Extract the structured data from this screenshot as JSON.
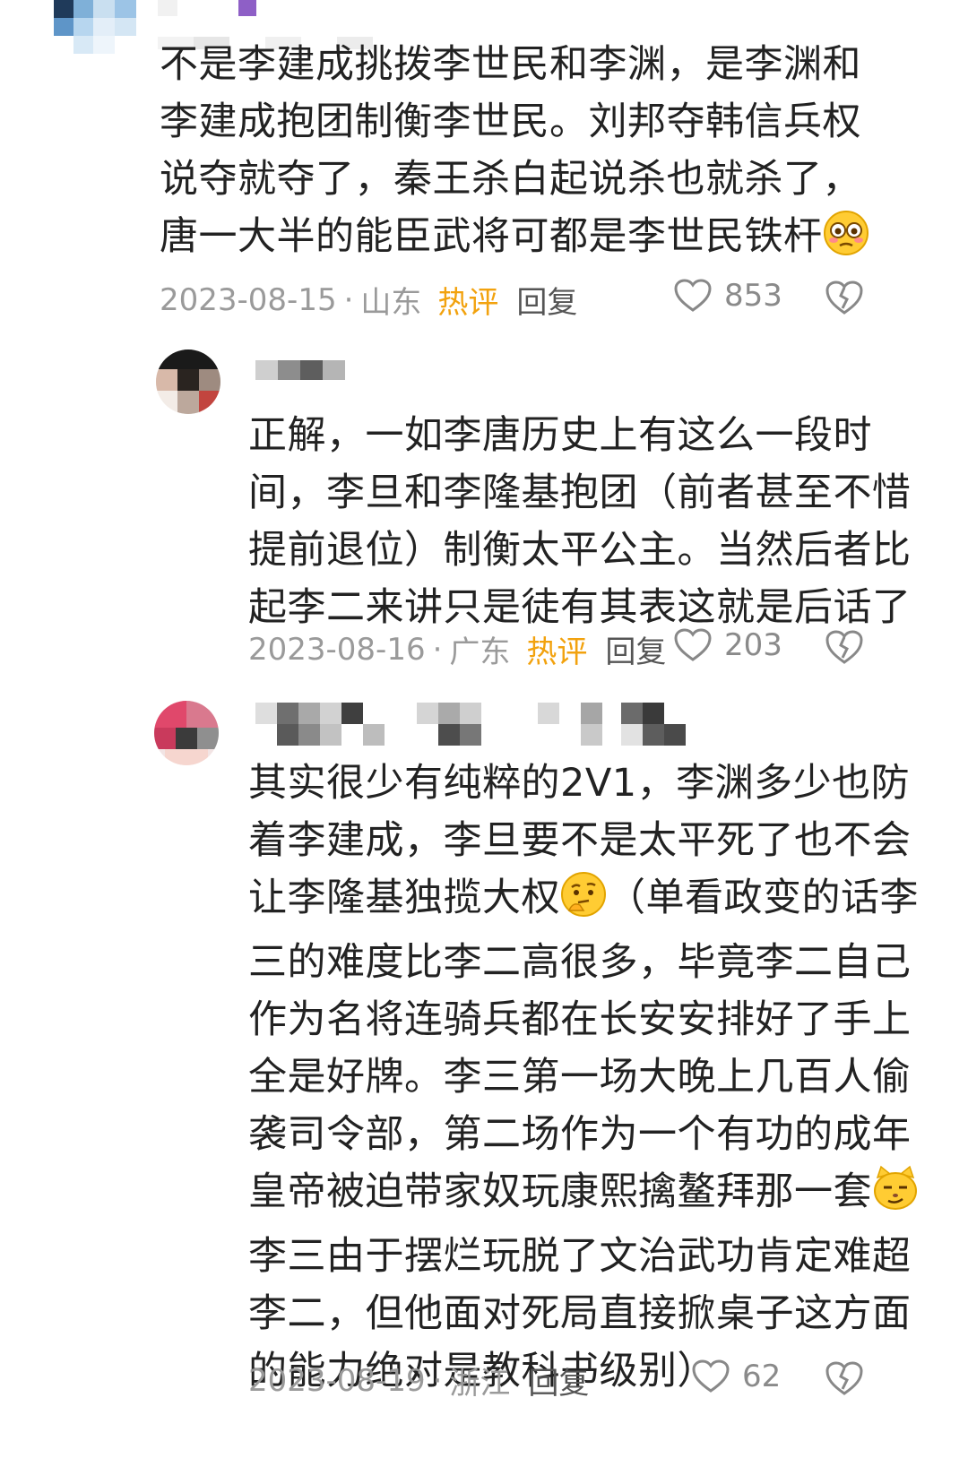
{
  "comments": [
    {
      "lines": [
        "不是李建成挑拨李世民和李渊，是李渊和",
        "李建成抱团制衡李世民。刘邦夺韩信兵权",
        "说夺就夺了，秦王杀白起说杀也就杀了，",
        "唐一大半的能臣武将可都是李世民铁杆"
      ],
      "emoji": "flushed-face-emoji",
      "date": "2023-08-15",
      "location": "山东",
      "hot": "热评",
      "reply": "回复",
      "likes": "853"
    },
    {
      "lines": [
        "正解，一如李唐历史上有这么一段时",
        "间，李旦和李隆基抱团（前者甚至不惜",
        "提前退位）制衡太平公主。当然后者比",
        "起李二来讲只是徒有其表这就是后话了"
      ],
      "date": "2023-08-16",
      "location": "广东",
      "hot": "热评",
      "reply": "回复",
      "likes": "203"
    },
    {
      "lines": [
        "其实很少有纯粹的2V1，李渊多少也防",
        "着李建成，李旦要不是太平死了也不会",
        "让李隆基独揽大权",
        "（单看政变的话李",
        "三的难度比李二高很多，毕竟李二自己",
        "作为名将连骑兵都在长安安排好了手上",
        "全是好牌。李三第一场大晚上几百人偷",
        "袭司令部，第二场作为一个有功的成年",
        "皇帝被迫带家奴玩康熙擒鳌拜那一套",
        "李三由于摆烂玩脱了文治武功肯定难超",
        "李二，但他面对死局直接掀桌子这方面",
        "的能力绝对是教科书级别）"
      ],
      "emojis": [
        "thinking-face-emoji",
        "smirking-cat-emoji"
      ],
      "date": "2023-08-19",
      "location": "浙江",
      "reply": "回复",
      "likes": "62"
    }
  ],
  "separator": "·",
  "colors": {
    "hot": "#f2a20e",
    "meta": "#9a9a9a",
    "text": "#222222"
  },
  "icons": {
    "like": "heart-outline-icon",
    "dislike": "broken-heart-icon"
  }
}
